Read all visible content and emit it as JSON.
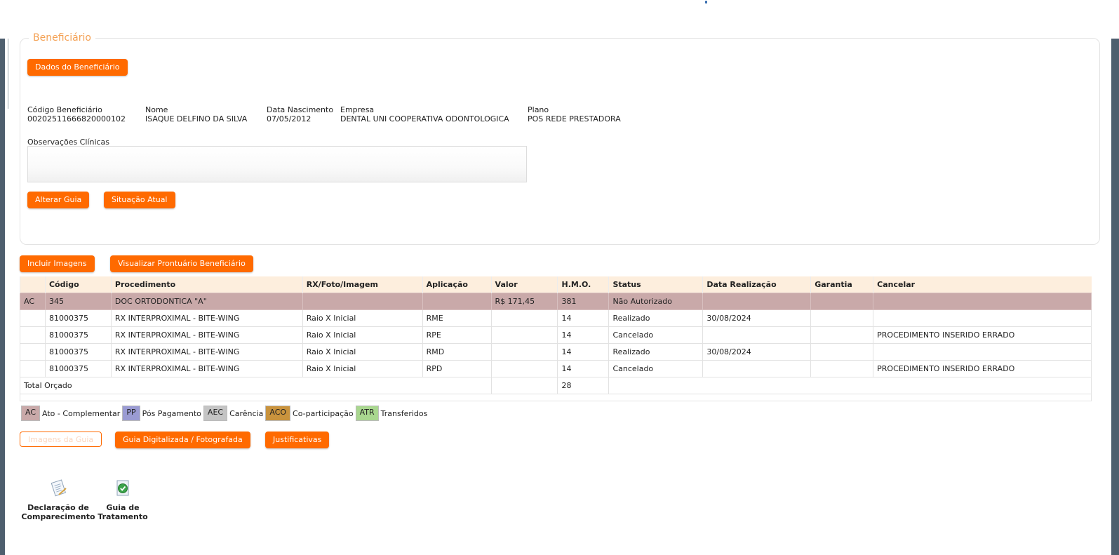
{
  "colors": {
    "accent": "#ff6a00",
    "legend_text": "#f4a154",
    "header_bg": "#fdeedd",
    "ac_row": "#c9a9a9",
    "sidebar": "#4e5f6e"
  },
  "beneficiario": {
    "legend": "Beneficiário",
    "dados_button": "Dados do Beneficiário",
    "fields": [
      {
        "label": "Código Beneficiário",
        "value": "00202511666820000102"
      },
      {
        "label": "Nome",
        "value": "ISAQUE DELFINO DA SILVA"
      },
      {
        "label": "Data Nascimento",
        "value": "07/05/2012"
      },
      {
        "label": "Empresa",
        "value": "DENTAL UNI COOPERATIVA ODONTOLOGICA"
      },
      {
        "label": "Plano",
        "value": "POS REDE PRESTADORA"
      }
    ],
    "obs_label": "Observações Clínicas",
    "obs_value": "",
    "alterar_button": "Alterar Guia",
    "situacao_button": "Situação Atual"
  },
  "actions": {
    "incluir_imagens": "Incluir Imagens",
    "visualizar_prontuario": "Visualizar Prontuário Beneficiário"
  },
  "table": {
    "headers": [
      "",
      "Código",
      "Procedimento",
      "RX/Foto/Imagem",
      "Aplicação",
      "Valor",
      "H.M.O.",
      "Status",
      "Data Realização",
      "Garantia",
      "Cancelar"
    ],
    "rows": [
      [
        "AC",
        "345",
        "DOC ORTODONTICA \"A\"",
        "",
        "",
        "R$ 171,45",
        "381",
        "Não Autorizado",
        "",
        "",
        ""
      ],
      [
        "",
        "81000375",
        "RX INTERPROXIMAL - BITE-WING",
        "Raio X Inicial",
        "RME",
        "",
        "14",
        "Realizado",
        "30/08/2024",
        "",
        ""
      ],
      [
        "",
        "81000375",
        "RX INTERPROXIMAL - BITE-WING",
        "Raio X Inicial",
        "RPE",
        "",
        "14",
        "Cancelado",
        "",
        "",
        "PROCEDIMENTO INSERIDO ERRADO"
      ],
      [
        "",
        "81000375",
        "RX INTERPROXIMAL - BITE-WING",
        "Raio X Inicial",
        "RMD",
        "",
        "14",
        "Realizado",
        "30/08/2024",
        "",
        ""
      ],
      [
        "",
        "81000375",
        "RX INTERPROXIMAL - BITE-WING",
        "Raio X Inicial",
        "RPD",
        "",
        "14",
        "Cancelado",
        "",
        "",
        "PROCEDIMENTO INSERIDO ERRADO"
      ]
    ],
    "total_label": "Total Orçado",
    "total_hmo": "28"
  },
  "legend": [
    {
      "code": "AC",
      "label": "Ato - Complementar",
      "color": "#c9a9a9"
    },
    {
      "code": "PP",
      "label": "Pós Pagamento",
      "color": "#9a9bd3"
    },
    {
      "code": "AEC",
      "label": "Carência",
      "color": "#c4c4c4"
    },
    {
      "code": "ACO",
      "label": "Co-participação",
      "color": "#c9933d"
    },
    {
      "code": "ATR",
      "label": "Transferidos",
      "color": "#a9d78f"
    }
  ],
  "bottom_buttons": {
    "imagens_guia": "Imagens da Guia",
    "guia_digitalizada": "Guia Digitalizada / Fotografada",
    "justificativas": "Justificativas"
  },
  "docs": [
    {
      "line1": "Declaração de",
      "line2": "Comparecimento",
      "icon": "document-icon"
    },
    {
      "line1": "Guia de",
      "line2": "Tratamento",
      "icon": "green-check-document-icon"
    }
  ]
}
